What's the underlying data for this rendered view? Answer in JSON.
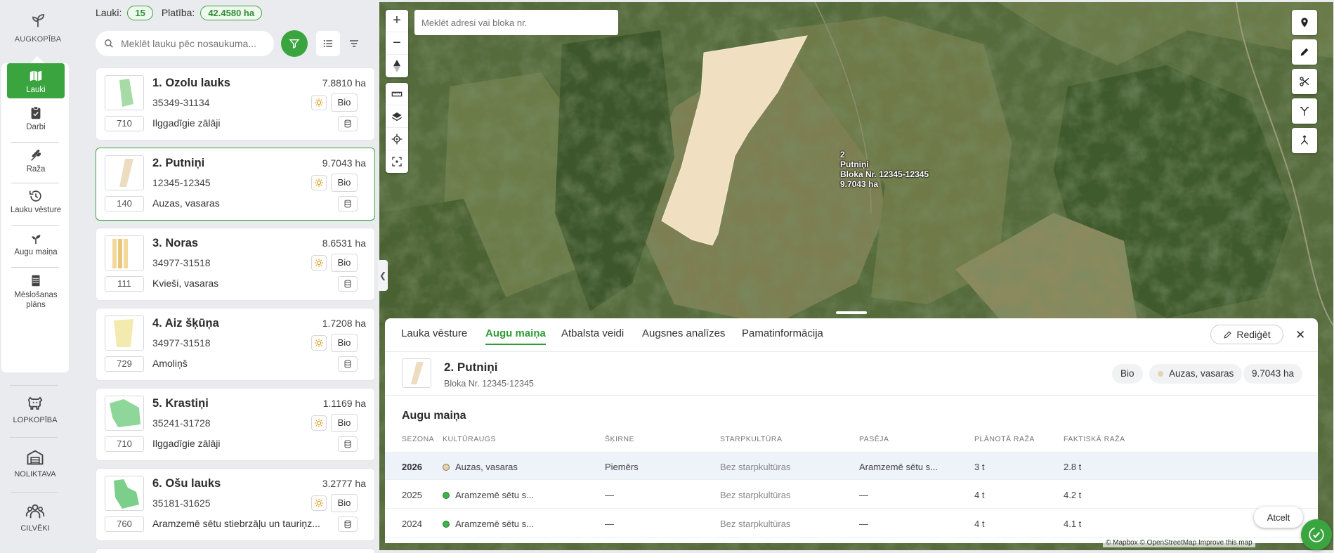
{
  "nav": {
    "top_label": "AUGKOPĪBA",
    "items": [
      {
        "label": "Lauki"
      },
      {
        "label": "Darbi"
      },
      {
        "label": "Raža"
      },
      {
        "label": "Lauku vēsture"
      },
      {
        "label": "Augu maiņa"
      },
      {
        "label": "Mēslošanas plāns"
      }
    ],
    "bottom": [
      {
        "label": "LOPKOPĪBA"
      },
      {
        "label": "NOLIKTAVA"
      },
      {
        "label": "CILVĒKI"
      }
    ]
  },
  "summary": {
    "fields_label": "Lauki:",
    "fields_count": "15",
    "area_label": "Platība:",
    "area_value": "42.4580 ha"
  },
  "search": {
    "placeholder": "Meklēt lauku pēc nosaukuma..."
  },
  "fields": [
    {
      "name": "1. Ozolu lauks",
      "block": "35349-31134",
      "area": "7.8810 ha",
      "num": "710",
      "crop": "Ilggadīgie zālāji",
      "bio": "Bio",
      "color": "#a6dba6"
    },
    {
      "name": "2. Putniņi",
      "block": "12345-12345",
      "area": "9.7043 ha",
      "num": "140",
      "crop": "Auzas, vasaras",
      "bio": "Bio",
      "color": "#eddcbf"
    },
    {
      "name": "3. Noras",
      "block": "34977-31518",
      "area": "8.6531 ha",
      "num": "111",
      "crop": "Kvieši, vasaras",
      "bio": "Bio",
      "color": "#f2d99a"
    },
    {
      "name": "4. Aiz šķūņa",
      "block": "34977-31518",
      "area": "1.7208 ha",
      "num": "729",
      "crop": "Amoliņš",
      "bio": "Bio",
      "color": "#f3eab0"
    },
    {
      "name": "5. Krastiņi",
      "block": "35241-31728",
      "area": "1.1169 ha",
      "num": "710",
      "crop": "Ilggadīgie zālāji",
      "bio": "Bio",
      "color": "#8fd69a"
    },
    {
      "name": "6. Ošu lauks",
      "block": "35181-31625",
      "area": "3.2777 ha",
      "num": "760",
      "crop": "Aramzemē sētu stiebrzāļu un tauriņz...",
      "bio": "Bio",
      "color": "#7ccf8a"
    }
  ],
  "map": {
    "search_placeholder": "Meklēt adresi vai bloka nr.",
    "label_lines": [
      "2",
      "Putniņi",
      "Bloka Nr. 12345-12345",
      "9.7043 ha"
    ],
    "field_color": "#f0dfc0",
    "attribution": "© Mapbox © OpenStreetMap Improve this map"
  },
  "panel": {
    "tabs": [
      "Lauka vēsture",
      "Augu maiņa",
      "Atbalsta veidi",
      "Augsnes analīzes",
      "Pamatinformācija"
    ],
    "active_tab": "Augu maiņa",
    "edit_label": "Rediģēt",
    "title": "2. Putniņi",
    "subtitle": "Bloka Nr. 12345-12345",
    "chip_bio": "Bio",
    "chip_crop": "Auzas, vasaras",
    "chip_area": "9.7043 ha",
    "section_title": "Augu maiņa",
    "columns": [
      "SEZONA",
      "KULTŪRAUGS",
      "ŠĶIRNE",
      "STARPKULTŪRA",
      "PASĒJA",
      "PLĀNOTĀ RAŽA",
      "FAKTISKĀ RAŽA"
    ],
    "rows": [
      {
        "season": "2026",
        "crop": "Auzas, vasaras",
        "dot": "#d9c7a0",
        "variety": "Piemērs",
        "cover": "Bez starpkultūras",
        "undersow": "Aramzemē sētu s...",
        "planned": "3 t",
        "actual": "2.8 t"
      },
      {
        "season": "2025",
        "crop": "Aramzemē sētu s...",
        "dot": "#3fb34c",
        "variety": "—",
        "cover": "Bez starpkultūras",
        "undersow": "—",
        "planned": "4 t",
        "actual": "4.2 t"
      },
      {
        "season": "2024",
        "crop": "Aramzemē sētu s...",
        "dot": "#3fb34c",
        "variety": "—",
        "cover": "Bez starpkultūras",
        "undersow": "—",
        "planned": "4 t",
        "actual": "4.1 t"
      }
    ],
    "cancel_label": "Atcelt"
  },
  "colors": {
    "accent": "#3aa53f"
  }
}
